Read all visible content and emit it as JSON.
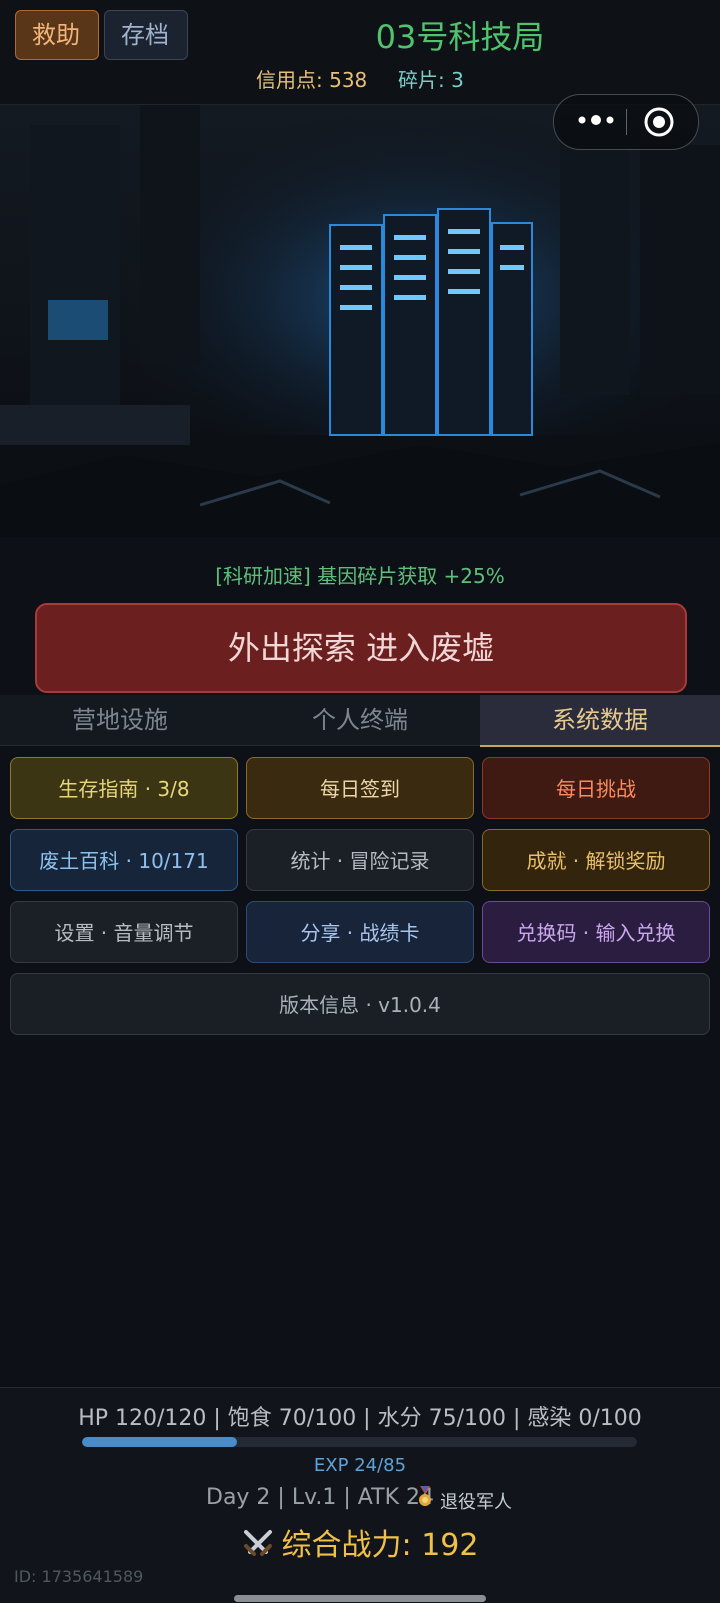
{
  "header": {
    "help_label": "救助",
    "save_label": "存档",
    "title": "03号科技局",
    "credit_text": "信用点: 538",
    "shard_text": "碎片: 3"
  },
  "buff_text": "[科研加速] 基因碎片获取 +25%",
  "explore_label": "外出探索 进入废墟",
  "tabs": [
    {
      "label": "营地设施",
      "active": false
    },
    {
      "label": "个人终端",
      "active": false
    },
    {
      "label": "系统数据",
      "active": true
    }
  ],
  "grid": [
    {
      "label": "生存指南 · 3/8"
    },
    {
      "label": "每日签到"
    },
    {
      "label": "每日挑战"
    },
    {
      "label": "废土百科 · 10/171"
    },
    {
      "label": "统计 · 冒险记录"
    },
    {
      "label": "成就 · 解锁奖励"
    },
    {
      "label": "设置 · 音量调节"
    },
    {
      "label": "分享 · 战绩卡"
    },
    {
      "label": "兑换码 · 输入兑换"
    }
  ],
  "version_label": "版本信息 · v1.0.4",
  "status": {
    "vitals": "HP 120/120 | 饱食 70/100 | 水分 75/100 | 感染 0/100",
    "exp_text": "EXP 24/85",
    "exp_fraction": 0.28,
    "info": "Day 2 | Lv.1 | ATK 24",
    "role": "退役军人",
    "power": "综合战力: 192",
    "id_text": "ID: 1735641589"
  },
  "icons": [
    "more-dots-icon",
    "target-icon",
    "medal-icon",
    "crossed-swords-icon"
  ],
  "colors": {
    "accent_green": "#4fc36e",
    "explore_red": "#6b1f1f",
    "tab_active": "#e6c98f",
    "power_gold": "#f0c048"
  }
}
